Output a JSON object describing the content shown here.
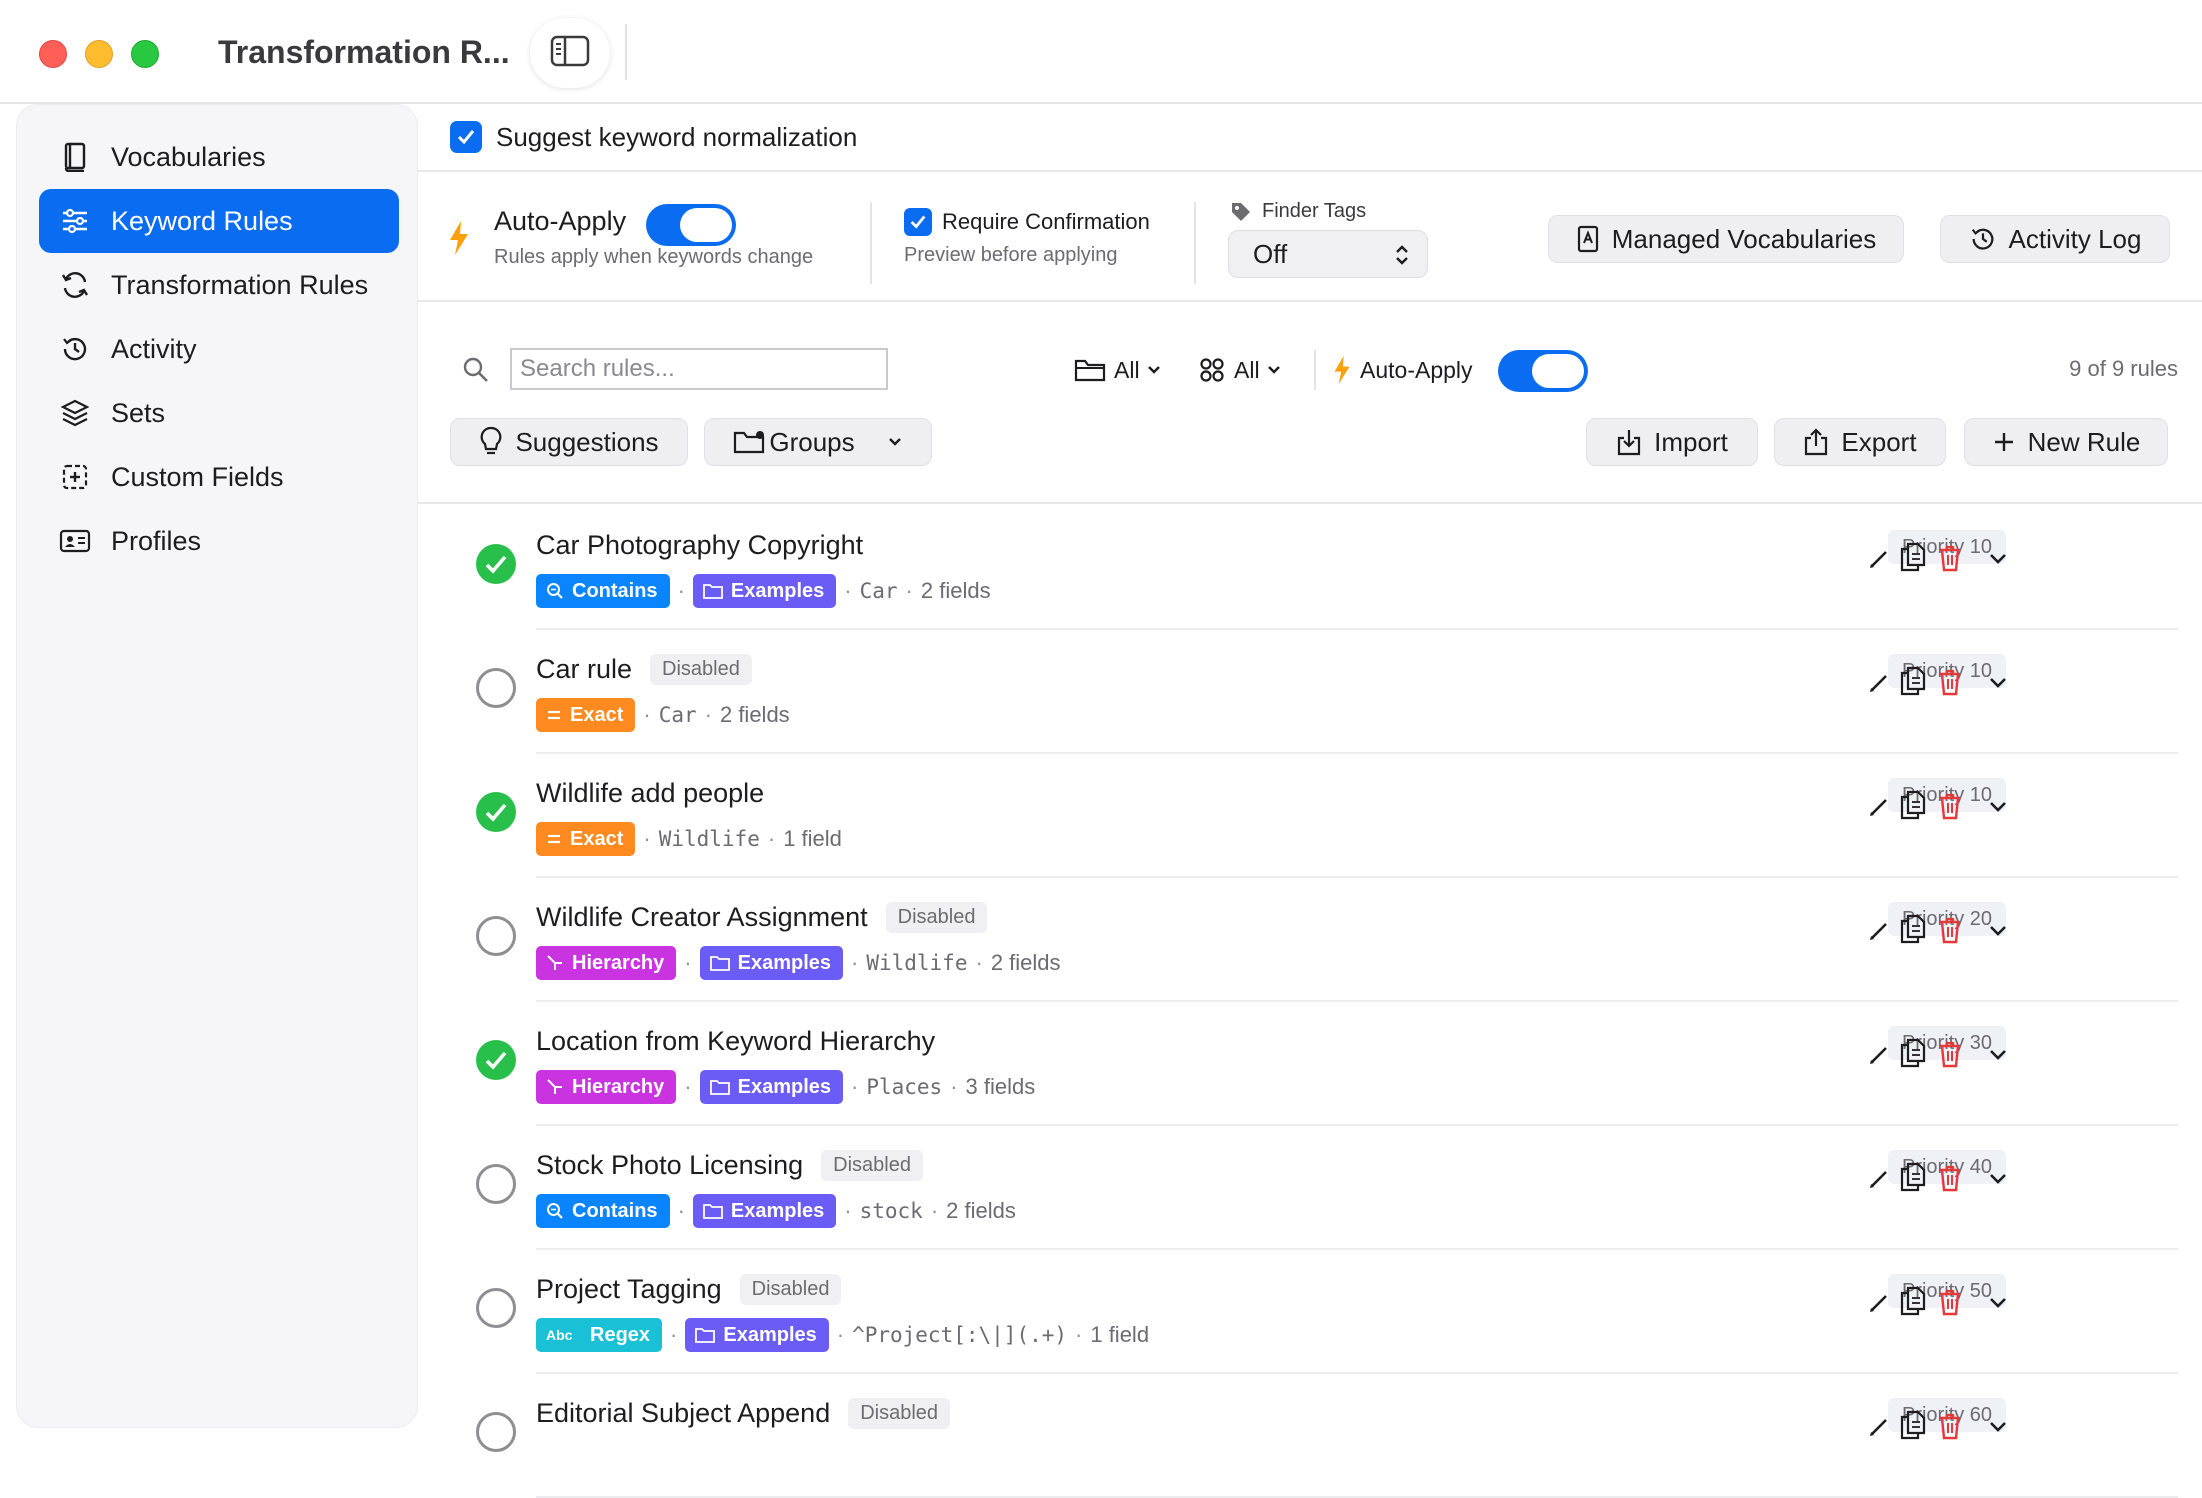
{
  "window": {
    "title": "Transformation R..."
  },
  "sidebar": {
    "items": [
      {
        "label": "Vocabularies",
        "icon": "book-icon"
      },
      {
        "label": "Keyword Rules",
        "icon": "sliders-icon",
        "active": true
      },
      {
        "label": "Transformation Rules",
        "icon": "refresh-icon"
      },
      {
        "label": "Activity",
        "icon": "history-icon"
      },
      {
        "label": "Sets",
        "icon": "layers-icon"
      },
      {
        "label": "Custom Fields",
        "icon": "custom-field-icon"
      },
      {
        "label": "Profiles",
        "icon": "id-card-icon"
      }
    ]
  },
  "suggest": {
    "label": "Suggest keyword normalization",
    "checked": true
  },
  "toolbar": {
    "auto_apply_label": "Auto-Apply",
    "auto_apply_sub": "Rules apply when keywords change",
    "require_confirmation_label": "Require Confirmation",
    "require_confirmation_sub": "Preview before applying",
    "finder_tags_label": "Finder Tags",
    "finder_tags_value": "Off",
    "managed_vocab_label": "Managed Vocabularies",
    "activity_log_label": "Activity Log"
  },
  "filters": {
    "search_placeholder": "Search rules...",
    "folder_filter": "All",
    "type_filter": "All",
    "auto_apply_label": "Auto-Apply",
    "count": "9 of 9 rules",
    "suggestions_label": "Suggestions",
    "groups_label": "Groups",
    "import_label": "Import",
    "export_label": "Export",
    "new_rule_label": "New Rule"
  },
  "colors": {
    "accent": "#0a6cf0",
    "enabled": "#28bf4b",
    "contains": "#0a84ff",
    "exact": "#ff8a1f",
    "hierarchy": "#c933e0",
    "regex": "#1ac1d6",
    "examples": "#6a5cf5",
    "delete": "#e5383b"
  },
  "rules": [
    {
      "name": "Car Photography Copyright",
      "enabled": true,
      "disabled_label": "",
      "match": "Contains",
      "match_type": "contains",
      "group": "Examples",
      "keyword": "Car",
      "fields": "2 fields",
      "priority": "Priority 10"
    },
    {
      "name": "Car rule",
      "enabled": false,
      "disabled_label": "Disabled",
      "match": "Exact",
      "match_type": "exact",
      "group": "",
      "keyword": "Car",
      "fields": "2 fields",
      "priority": "Priority 10"
    },
    {
      "name": "Wildlife add people",
      "enabled": true,
      "disabled_label": "",
      "match": "Exact",
      "match_type": "exact",
      "group": "",
      "keyword": "Wildlife",
      "fields": "1 field",
      "priority": "Priority 10"
    },
    {
      "name": "Wildlife Creator Assignment",
      "enabled": false,
      "disabled_label": "Disabled",
      "match": "Hierarchy",
      "match_type": "hierarchy",
      "group": "Examples",
      "keyword": "Wildlife",
      "fields": "2 fields",
      "priority": "Priority 20"
    },
    {
      "name": "Location from Keyword Hierarchy",
      "enabled": true,
      "disabled_label": "",
      "match": "Hierarchy",
      "match_type": "hierarchy",
      "group": "Examples",
      "keyword": "Places",
      "fields": "3 fields",
      "priority": "Priority 30"
    },
    {
      "name": "Stock Photo Licensing",
      "enabled": false,
      "disabled_label": "Disabled",
      "match": "Contains",
      "match_type": "contains",
      "group": "Examples",
      "keyword": "stock",
      "fields": "2 fields",
      "priority": "Priority 40"
    },
    {
      "name": "Project Tagging",
      "enabled": false,
      "disabled_label": "Disabled",
      "match": "Regex",
      "match_type": "regex",
      "group": "Examples",
      "keyword": "^Project[:\\|](.+)",
      "fields": "1 field",
      "priority": "Priority 50"
    },
    {
      "name": "Editorial Subject Append",
      "enabled": false,
      "disabled_label": "Disabled",
      "match": "",
      "match_type": "",
      "group": "",
      "keyword": "",
      "fields": "",
      "priority": "Priority 60"
    }
  ]
}
